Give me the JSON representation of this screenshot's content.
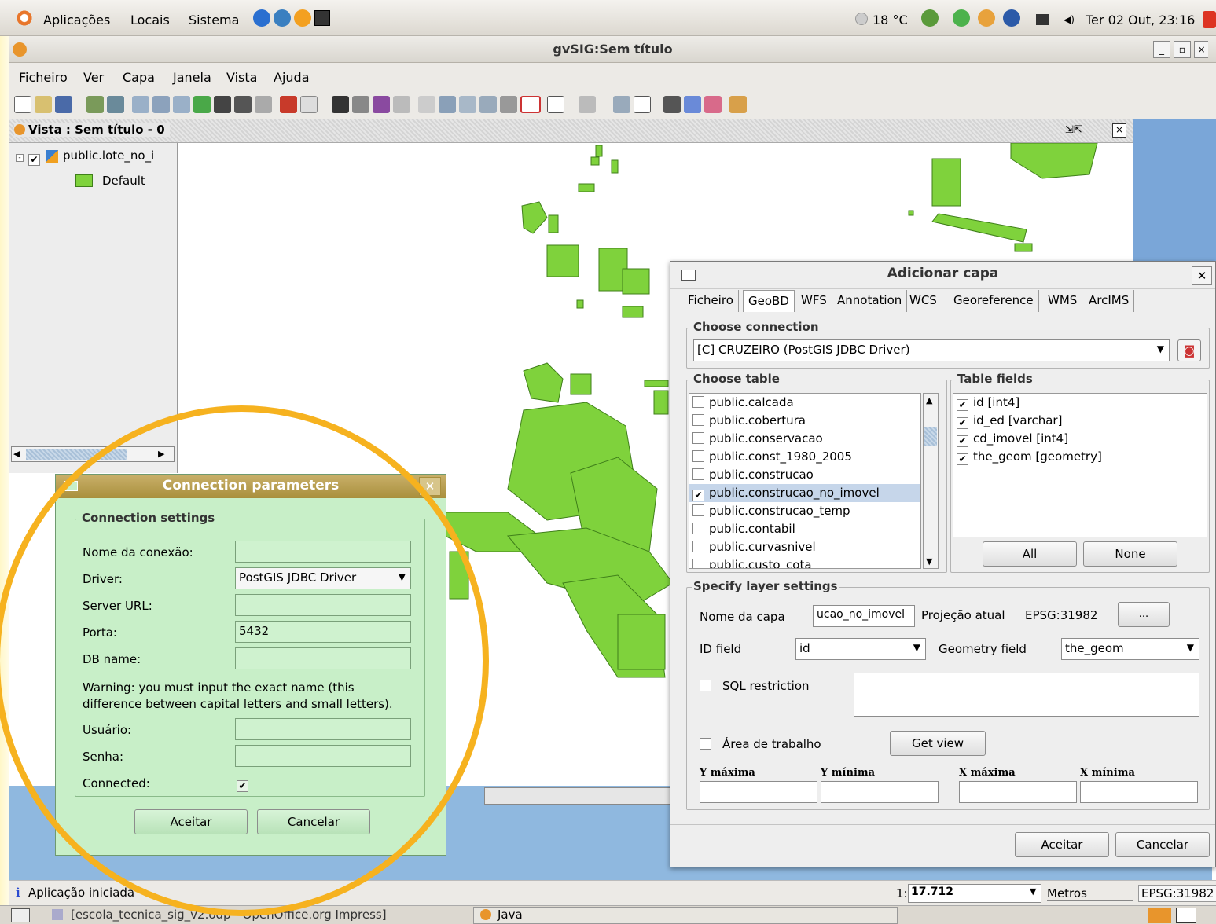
{
  "panel": {
    "applications": "Aplicações",
    "places": "Locais",
    "system": "Sistema",
    "weather": "18 °C",
    "clock": "Ter 02 Out, 23:16"
  },
  "window": {
    "title": "gvSIG:Sem título"
  },
  "menu": [
    "Ficheiro",
    "Ver",
    "Capa",
    "Janela",
    "Vista",
    "Ajuda"
  ],
  "view": {
    "title": "Vista : Sem título - 0"
  },
  "toc": {
    "layer": "public.lote_no_i",
    "legend": "Default"
  },
  "status": {
    "message": "Aplicação iniciada",
    "scale_prefix": "1:",
    "scale_value": "17.712",
    "units": "Metros",
    "crs": "EPSG:31982"
  },
  "taskbar": {
    "item1": "[escola_tecnica_sig_v2.odp - OpenOffice.org Impress]",
    "item2": "Java"
  },
  "add_layer": {
    "title": "Adicionar capa",
    "tabs": [
      "Ficheiro",
      "GeoBD",
      "WFS",
      "Annotation",
      "WCS",
      "Georeference",
      "WMS",
      "ArcIMS"
    ],
    "choose_connection": "Choose connection",
    "connection_value": "[C] CRUZEIRO (PostGIS JDBC Driver)",
    "choose_table": "Choose table",
    "tables": [
      {
        "name": "public.calcada",
        "checked": false
      },
      {
        "name": "public.cobertura",
        "checked": false
      },
      {
        "name": "public.conservacao",
        "checked": false
      },
      {
        "name": "public.const_1980_2005",
        "checked": false
      },
      {
        "name": "public.construcao",
        "checked": false
      },
      {
        "name": "public.construcao_no_imovel",
        "checked": true
      },
      {
        "name": "public.construcao_temp",
        "checked": false
      },
      {
        "name": "public.contabil",
        "checked": false
      },
      {
        "name": "public.curvasnivel",
        "checked": false
      },
      {
        "name": "public.custo_cota",
        "checked": false
      }
    ],
    "table_fields": "Table fields",
    "fields": [
      {
        "name": "id [int4]",
        "checked": true
      },
      {
        "name": "id_ed [varchar]",
        "checked": true
      },
      {
        "name": "cd_imovel [int4]",
        "checked": true
      },
      {
        "name": "the_geom [geometry]",
        "checked": true
      }
    ],
    "all_button": "All",
    "none_button": "None",
    "specify_layer": "Specify layer settings",
    "layer_name_label": "Nome da capa",
    "layer_name_value": "ucao_no_imovel",
    "projection_label": "Projeção atual",
    "projection_value": "EPSG:31982",
    "dots_button": "...",
    "id_field_label": "ID field",
    "id_field_value": "id",
    "geom_field_label": "Geometry field",
    "geom_field_value": "the_geom",
    "sql_label": "SQL restriction",
    "workarea_label": "Área de trabalho",
    "getview_button": "Get view",
    "ymax": "Y máxima",
    "ymin": "Y mínima",
    "xmax": "X máxima",
    "xmin": "X mínima",
    "ok": "Aceitar",
    "cancel": "Cancelar"
  },
  "conn_params": {
    "title": "Connection parameters",
    "settings": "Connection settings",
    "name_label": "Nome da conexão:",
    "driver_label": "Driver:",
    "driver_value": "PostGIS JDBC Driver",
    "url_label": "Server URL:",
    "port_label": "Porta:",
    "port_value": "5432",
    "db_label": "DB name:",
    "warning_line1": "Warning: you must input the exact name (this",
    "warning_line2": "difference between capital letters and small letters).",
    "user_label": "Usuário:",
    "pass_label": "Senha:",
    "connected_label": "Connected:",
    "ok": "Aceitar",
    "cancel": "Cancelar"
  },
  "colors": {
    "parcel_fill": "#7fd23c",
    "parcel_stroke": "#3f7f1a",
    "highlight": "#f6b21f"
  }
}
